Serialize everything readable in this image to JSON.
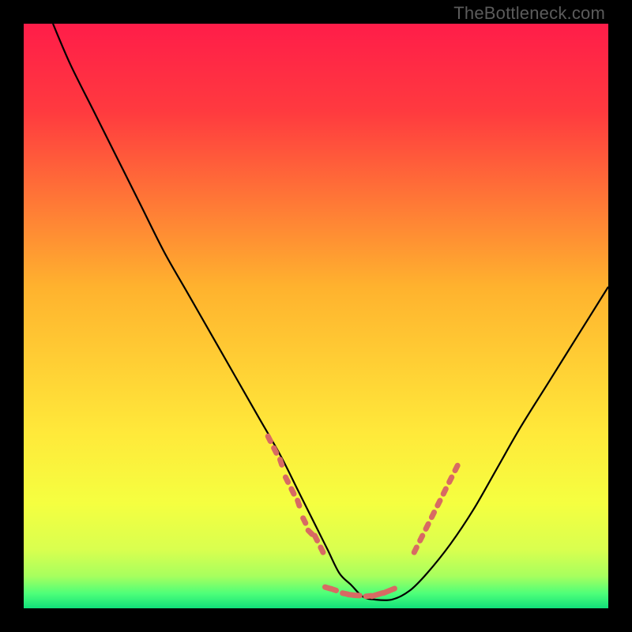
{
  "watermark": "TheBottleneck.com",
  "chart_data": {
    "type": "line",
    "title": "",
    "xlabel": "",
    "ylabel": "",
    "xlim": [
      0,
      100
    ],
    "ylim": [
      0,
      100
    ],
    "background_gradient": {
      "stops": [
        {
          "pos": 0.0,
          "color": "#ff1d49"
        },
        {
          "pos": 0.15,
          "color": "#ff3a3f"
        },
        {
          "pos": 0.45,
          "color": "#ffb22e"
        },
        {
          "pos": 0.7,
          "color": "#ffe93a"
        },
        {
          "pos": 0.82,
          "color": "#f5ff40"
        },
        {
          "pos": 0.9,
          "color": "#d9ff4f"
        },
        {
          "pos": 0.945,
          "color": "#a7ff5e"
        },
        {
          "pos": 0.975,
          "color": "#4dff79"
        },
        {
          "pos": 1.0,
          "color": "#11e07a"
        }
      ]
    },
    "series": [
      {
        "name": "bottleneck-curve",
        "color": "#000000",
        "x": [
          5,
          8,
          12,
          16,
          20,
          24,
          28,
          32,
          36,
          40,
          44,
          47,
          50,
          52,
          54,
          56,
          58,
          60,
          63,
          66,
          69,
          73,
          77,
          81,
          85,
          90,
          95,
          100
        ],
        "y": [
          100,
          93,
          85,
          77,
          69,
          61,
          54,
          47,
          40,
          33,
          26,
          20,
          14,
          10,
          6,
          4,
          2,
          1.5,
          1.5,
          3,
          6,
          11,
          17,
          24,
          31,
          39,
          47,
          55
        ]
      },
      {
        "name": "highlight-dots-left",
        "type": "scatter",
        "color": "#d86a63",
        "x": [
          42,
          43,
          44,
          45,
          46,
          47,
          48,
          49,
          50,
          51
        ],
        "y": [
          29,
          27,
          25,
          22,
          20,
          18,
          15,
          13,
          12,
          10
        ]
      },
      {
        "name": "highlight-dots-bottom",
        "type": "scatter",
        "color": "#d86a63",
        "x": [
          52,
          53,
          55,
          56,
          57,
          59,
          60,
          61,
          62,
          63
        ],
        "y": [
          3.5,
          3.2,
          2.5,
          2.3,
          2.2,
          2.1,
          2.2,
          2.5,
          2.8,
          3.2
        ]
      },
      {
        "name": "highlight-dots-right",
        "type": "scatter",
        "color": "#d86a63",
        "x": [
          67,
          68,
          69,
          70,
          71,
          72,
          73,
          74
        ],
        "y": [
          10,
          12,
          14,
          16,
          18,
          20,
          22,
          24
        ]
      }
    ]
  }
}
